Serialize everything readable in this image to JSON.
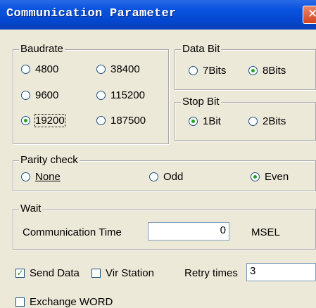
{
  "window": {
    "title": "Communication Parameter"
  },
  "baudrate": {
    "legend": "Baudrate",
    "options": [
      "4800",
      "38400",
      "9600",
      "115200",
      "19200",
      "187500"
    ],
    "selected": "19200"
  },
  "data_bit": {
    "legend": "Data Bit",
    "options": [
      "7Bits",
      "8Bits"
    ],
    "selected": "8Bits"
  },
  "stop_bit": {
    "legend": "Stop Bit",
    "options": [
      "1Bit",
      "2Bits"
    ],
    "selected": "1Bit"
  },
  "parity": {
    "legend": "Parity check",
    "options": [
      "None",
      "Odd",
      "Even"
    ],
    "selected": "Even"
  },
  "wait": {
    "legend": "Wait",
    "comm_time_label": "Communication Time",
    "comm_time_value": "0",
    "unit": "MSEL"
  },
  "send_data": {
    "label": "Send Data",
    "checked": true
  },
  "vir_station": {
    "label": "Vir Station",
    "checked": false
  },
  "retry": {
    "label": "Retry times",
    "value": "3"
  },
  "exchange_word": {
    "label": "Exchange WORD",
    "checked": false
  },
  "icons": {
    "close": "close-icon"
  }
}
